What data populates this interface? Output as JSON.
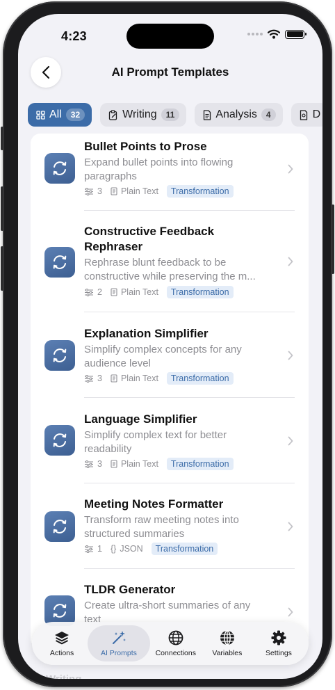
{
  "status_bar": {
    "time": "4:23"
  },
  "nav": {
    "title": "AI Prompt Templates"
  },
  "colors": {
    "accent": "#3c6ca8",
    "tag_bg": "#e3ecf8",
    "icon_gradient_top": "#5b7fb3",
    "icon_gradient_bottom": "#3d5f92"
  },
  "filters": [
    {
      "label": "All",
      "count": "32",
      "icon": "grid-icon",
      "selected": true
    },
    {
      "label": "Writing",
      "count": "11",
      "icon": "clipboard-pen-icon",
      "selected": false
    },
    {
      "label": "Analysis",
      "count": "4",
      "icon": "document-icon",
      "selected": false
    },
    {
      "label": "D",
      "count": "",
      "icon": "doc-search-icon",
      "selected": false
    }
  ],
  "templates": [
    {
      "title": "Bullet Points to Prose",
      "description": "Expand bullet points into flowing paragraphs",
      "variables": "3",
      "format": "Plain Text",
      "category": "Transformation",
      "icon": "refresh-icon"
    },
    {
      "title": "Constructive Feedback Rephraser",
      "description": "Rephrase blunt feedback to be constructive while preserving the m...",
      "variables": "2",
      "format": "Plain Text",
      "category": "Transformation",
      "icon": "refresh-icon"
    },
    {
      "title": "Explanation Simplifier",
      "description": "Simplify complex concepts for any audience level",
      "variables": "3",
      "format": "Plain Text",
      "category": "Transformation",
      "icon": "refresh-icon"
    },
    {
      "title": "Language Simplifier",
      "description": "Simplify complex text for better readability",
      "variables": "3",
      "format": "Plain Text",
      "category": "Transformation",
      "icon": "refresh-icon"
    },
    {
      "title": "Meeting Notes Formatter",
      "description": "Transform raw meeting notes into structured summaries",
      "variables": "1",
      "format": "JSON",
      "format_symbol": "{}",
      "category": "Transformation",
      "icon": "refresh-icon"
    },
    {
      "title": "TLDR Generator",
      "description": "Create ultra-short summaries of any text",
      "variables": "",
      "format": "",
      "category": "",
      "icon": "refresh-icon"
    }
  ],
  "tab_bar": [
    {
      "label": "Actions",
      "icon": "layers-icon",
      "selected": false
    },
    {
      "label": "AI Prompts",
      "icon": "sparkle-wand-icon",
      "selected": true
    },
    {
      "label": "Connections",
      "icon": "globe-icon",
      "selected": false
    },
    {
      "label": "Variables",
      "icon": "globe-grid-icon",
      "selected": false
    },
    {
      "label": "Settings",
      "icon": "gear-icon",
      "selected": false
    }
  ],
  "below_fold_heading": "Writing"
}
